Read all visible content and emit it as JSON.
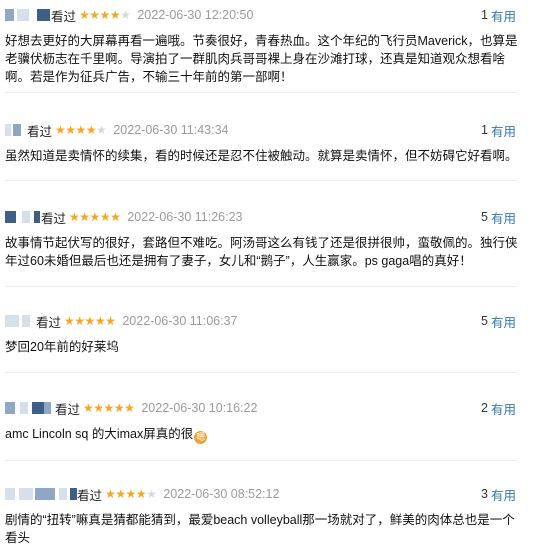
{
  "reviews": [
    {
      "watched": "看过",
      "rating": 4,
      "time": "2022-06-30 12:20:50",
      "votes": "1",
      "useful": "有用",
      "content": "好想去更好的大屏幕再看一遍哦。节奏很好，青春热血。这个年纪的飞行员Maverick，也算是老骥伏枥志在千里啊。导演拍了一群肌肉兵哥哥裸上身在沙滩打球，还真是知道观众想看啥啊。若是作为征兵广告，不输三十年前的第一部啊！"
    },
    {
      "watched": "看过",
      "rating": 4,
      "time": "2022-06-30 11:43:34",
      "votes": "1",
      "useful": "有用",
      "content": "虽然知道是卖情怀的续集，看的时候还是忍不住被触动。就算是卖情怀，但不妨碍它好看啊。"
    },
    {
      "watched": "看过",
      "rating": 5,
      "time": "2022-06-30 11:26:23",
      "votes": "5",
      "useful": "有用",
      "content": "故事情节起伏写的很好，套路但不难吃。阿汤哥这么有钱了还是很拼很帅，蛮敬佩的。独行侠年过60未婚但最后也还是拥有了妻子，女儿和“鹅子”，人生赢家。ps gaga唱的真好！"
    },
    {
      "watched": "看过",
      "rating": 5,
      "time": "2022-06-30 11:06:37",
      "votes": "5",
      "useful": "有用",
      "content": "梦回20年前的好莱坞"
    },
    {
      "watched": "看过",
      "rating": 5,
      "time": "2022-06-30 10:16:22",
      "votes": "2",
      "useful": "有用",
      "content": "amc Lincoln sq 的大imax屏真的很",
      "emoji": "嗯"
    },
    {
      "watched": "看过",
      "rating": 4,
      "time": "2022-06-30 08:52:12",
      "votes": "3",
      "useful": "有用",
      "content": "剧情的“扭转”嘛真是猜都能猜到，最爱beach volleyball那一场就对了，鲜美的肉体总也是一个看头"
    }
  ],
  "colors": {
    "star": "#f5a623",
    "star_off": "#d9d9d9",
    "useful_link": "#3377aa",
    "timestamp": "#9a9a9a"
  }
}
